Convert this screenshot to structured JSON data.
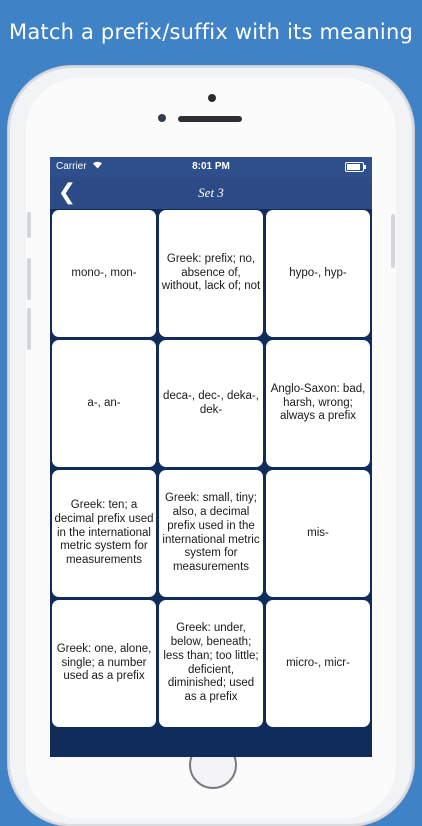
{
  "headline": "Match a prefix/suffix with its meaning",
  "status_bar": {
    "carrier": "Carrier",
    "wifi_icon": "wifi-icon",
    "time": "8:01 PM",
    "battery_icon": "battery-icon"
  },
  "nav": {
    "back_icon": "chevron-left-icon",
    "back_glyph": "❮",
    "title": "Set 3"
  },
  "cards": [
    "mono-, mon-",
    "Greek: prefix; no, absence of, without, lack of; not",
    "hypo-, hyp-",
    "a-, an-",
    "deca-, dec-, deka-, dek-",
    "Anglo-Saxon: bad, harsh, wrong; always a prefix",
    "Greek: ten; a decimal prefix used in the international metric system for measurements",
    "Greek: small, tiny; also, a decimal prefix used in the international metric system for measurements",
    "mis-",
    "Greek: one, alone, single; a number used as a prefix",
    "Greek: under, below, beneath; less than; too little; deficient, diminished; used as a prefix",
    "micro-, micr-"
  ],
  "colors": {
    "background": "#3f82c6",
    "nav_bar": "#2c4b86",
    "grid_background": "#102c5a",
    "card": "#ffffff"
  }
}
